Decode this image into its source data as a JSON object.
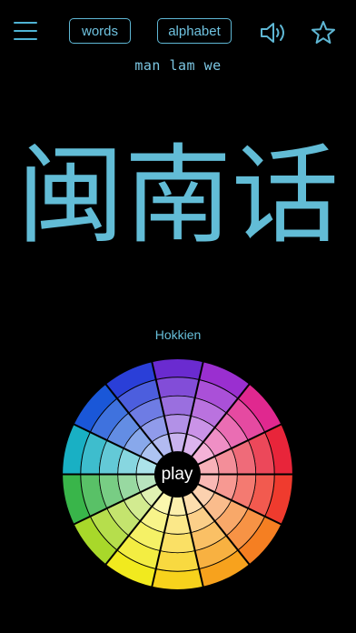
{
  "toolbar": {
    "menu_icon": "hamburger-menu-icon",
    "words_label": "words",
    "alphabet_label": "alphabet",
    "sound_icon": "speaker-icon",
    "favorite_icon": "star-icon"
  },
  "phrase": {
    "romanization": "man lam we",
    "characters": "闽南话",
    "language": "Hokkien"
  },
  "wheel": {
    "play_label": "play",
    "segment_colors": [
      "#6a2bd0",
      "#9a2fd0",
      "#e0288f",
      "#e8253a",
      "#ef3b2e",
      "#f57f22",
      "#f7a21d",
      "#f7d21c",
      "#f1ea1e",
      "#a8d82a",
      "#39b54a",
      "#19b0c4",
      "#1a57d8",
      "#2a3fd8"
    ],
    "center_color": "#000000",
    "ring_count": 5
  },
  "colors": {
    "accent": "#5fb7d4",
    "background": "#000000"
  }
}
